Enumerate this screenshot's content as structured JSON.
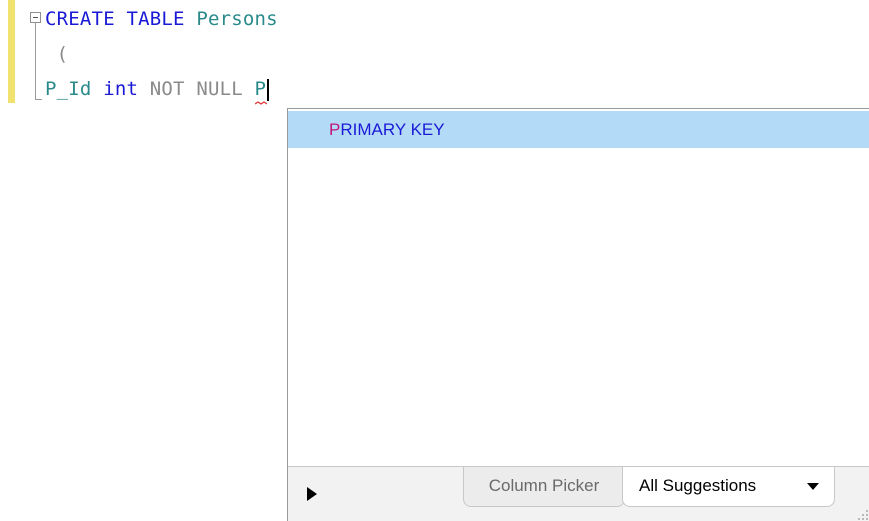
{
  "editor": {
    "line1": {
      "kw1": "CREATE",
      "kw2": "TABLE",
      "name": "Persons"
    },
    "line2": {
      "paren": "("
    },
    "line3": {
      "col": "P_Id",
      "type": "int",
      "constraint": "NOT NULL",
      "typed": "P"
    }
  },
  "popup": {
    "suggestion": {
      "match": "P",
      "rest": "RIMARY KEY"
    },
    "tabs": {
      "column_picker": "Column Picker",
      "all_suggestions": "All Suggestions"
    }
  },
  "colors": {
    "keyword": "#1a1ad6",
    "identifier": "#2a8a8a",
    "highlight": "#b3dbf8",
    "match": "#c0177a",
    "change_bar": "#f1e26f"
  },
  "icons": [
    "collapse-icon",
    "play-icon",
    "dropdown-arrow-icon",
    "resize-grip-icon"
  ]
}
